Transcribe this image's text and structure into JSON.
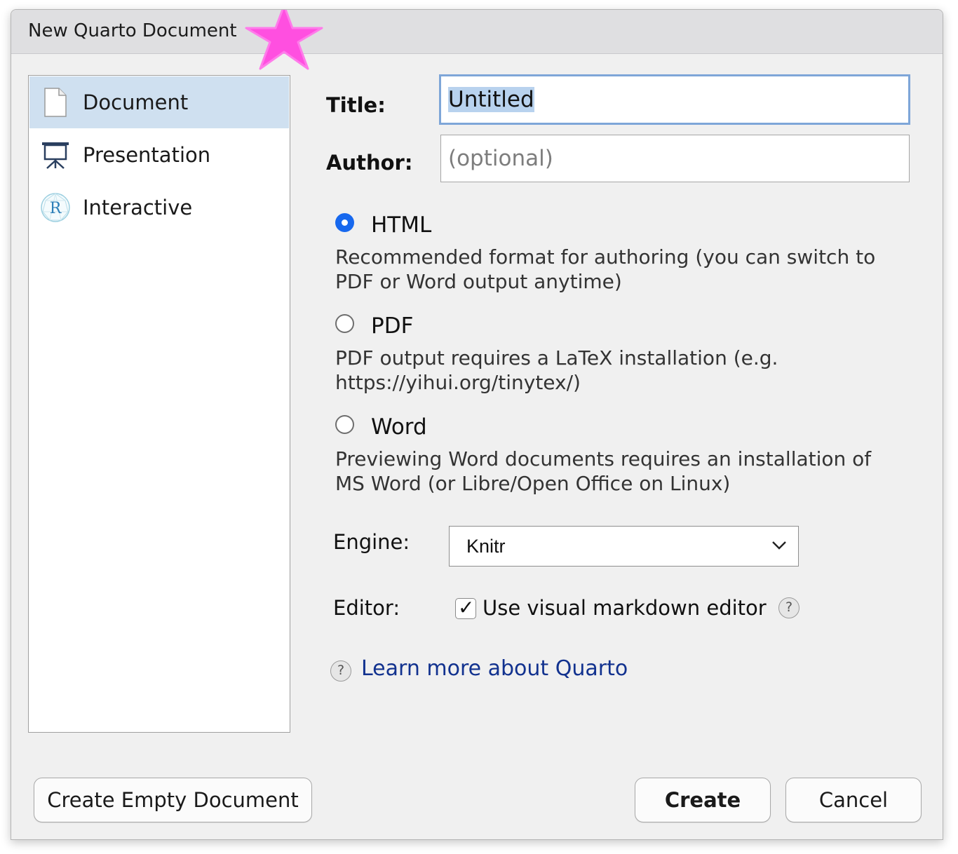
{
  "window": {
    "title": "New Quarto Document"
  },
  "doc_types": [
    {
      "label": "Document",
      "icon": "document-icon",
      "selected": true
    },
    {
      "label": "Presentation",
      "icon": "presentation-icon",
      "selected": false
    },
    {
      "label": "Interactive",
      "icon": "r-shiny-icon",
      "selected": false
    }
  ],
  "form": {
    "title_label": "Title:",
    "title_value": "Untitled",
    "author_label": "Author:",
    "author_placeholder": "(optional)",
    "author_value": ""
  },
  "formats": [
    {
      "label": "HTML",
      "checked": true,
      "desc_line1": "Recommended format for authoring (you can switch to",
      "desc_line2": "PDF or Word output anytime)"
    },
    {
      "label": "PDF",
      "checked": false,
      "desc_line1": "PDF output requires a LaTeX installation (e.g.",
      "desc_line2": "https://yihui.org/tinytex/)"
    },
    {
      "label": "Word",
      "checked": false,
      "desc_line1": "Previewing Word documents requires an installation of",
      "desc_line2": "MS Word (or Libre/Open Office on Linux)"
    }
  ],
  "engine": {
    "label": "Engine:",
    "value": "Knitr"
  },
  "editor": {
    "label": "Editor:",
    "checkbox_label": "Use visual markdown editor",
    "checked": true,
    "checkmark": "✓"
  },
  "help": {
    "glyph": "?",
    "link_text": "Learn more about Quarto"
  },
  "buttons": {
    "create_empty": "Create Empty Document",
    "create": "Create",
    "cancel": "Cancel"
  },
  "colors": {
    "accent": "#1768ee",
    "selection": "#cfe0f0",
    "link": "#12328f",
    "star": "#ff4fe0"
  }
}
